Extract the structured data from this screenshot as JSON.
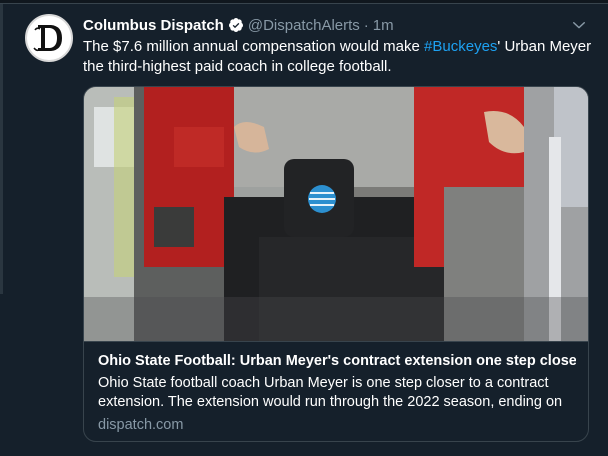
{
  "tweet": {
    "author_name": "Columbus Dispatch",
    "handle": "@DispatchAlerts",
    "separator": "·",
    "time": "1m",
    "text_before": "The $7.6 million annual compensation would make ",
    "hashtag": "#Buckeyes",
    "text_after": "' Urban Meyer the third-highest paid coach in college football."
  },
  "card": {
    "title": "Ohio State Football: Urban Meyer's contract extension one step closer",
    "description": "Ohio State football coach Urban Meyer is one step closer to a contract extension. The extension would run through the 2022 season, ending on",
    "domain": "dispatch.com"
  },
  "colors": {
    "background": "#15202b",
    "accent": "#1da1f2",
    "secondary_text": "#8899a6",
    "border": "#38444d"
  },
  "icons": {
    "avatar": "dispatch-logo-icon",
    "verified": "verified-badge-icon",
    "menu": "chevron-down-icon"
  }
}
